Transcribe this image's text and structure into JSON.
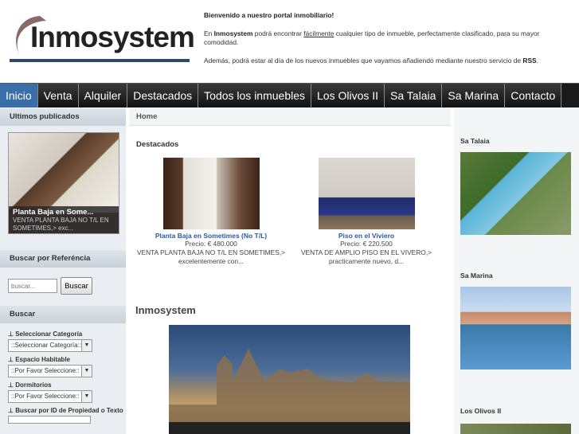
{
  "header": {
    "logo_text": "Inmosystem",
    "welcome": "Bienvenido a nuestro portal inmobiliario!",
    "line2_prefix": "En ",
    "line2_brand": "Inmosystem",
    "line2_mid": " podrá encontrar ",
    "line2_link": "fácilmente",
    "line2_suffix": " cualquier tipo de inmueble, perfectamente clasificado, para su mayor comodidad.",
    "line3_prefix": "Además, podrá estar al día de los nuevos inmuebles que vayamos añadiendo mediante nuestro servicio de ",
    "line3_rss": "RSS",
    "line3_suffix": "."
  },
  "nav": {
    "items": [
      "Inicio",
      "Venta",
      "Alquiler",
      "Destacados",
      "Todos los inmuebles",
      "Los Olivos II",
      "Sa Talaia",
      "Sa Marina",
      "Contacto"
    ],
    "active_color": "#3a6ea8"
  },
  "left": {
    "latest_heading": "Ultimos publicados",
    "latest_title": "Planta Baja en Some...",
    "latest_desc": "VENTA PLANTA BAJA NO T/L EN SOMETIMES,> exc...",
    "ref_heading": "Buscar por Referéncia",
    "search_placeholder": "buscar...",
    "search_button": "Buscar",
    "search_heading": "Buscar",
    "f1_label": "Seleccionar Categoría",
    "f1_value": "::Seleccionar Categoría::",
    "f2_label": "Espacio Habitable",
    "f2_value": "::Por Favor Seleccione::",
    "f3_label": "Dormitorios",
    "f3_value": "::Por Favor Seleccione::",
    "f4_label": "Buscar por ID de Propiedad o Texto"
  },
  "center": {
    "breadcrumb": "Home",
    "featured_heading": "Destacados",
    "cards": [
      {
        "title": "Planta Baja en Sometimes (No T/L)",
        "price": "Precio: € 480.000",
        "desc1": "VENTA PLANTA BAJA NO T/L EN SOMETIMES,>",
        "desc2": "excelentemente con..."
      },
      {
        "title": "Piso en el Viviero",
        "price": "Precio: € 220.500",
        "desc1": "VENTA DE AMPLIO PISO EN EL VIVERO,>",
        "desc2": "practicamente nuevo, d..."
      }
    ],
    "section_heading": "Inmosystem"
  },
  "right": {
    "h1": "Sa Talaia",
    "h2": "Sa Marina",
    "h3": "Los Olivos II"
  }
}
